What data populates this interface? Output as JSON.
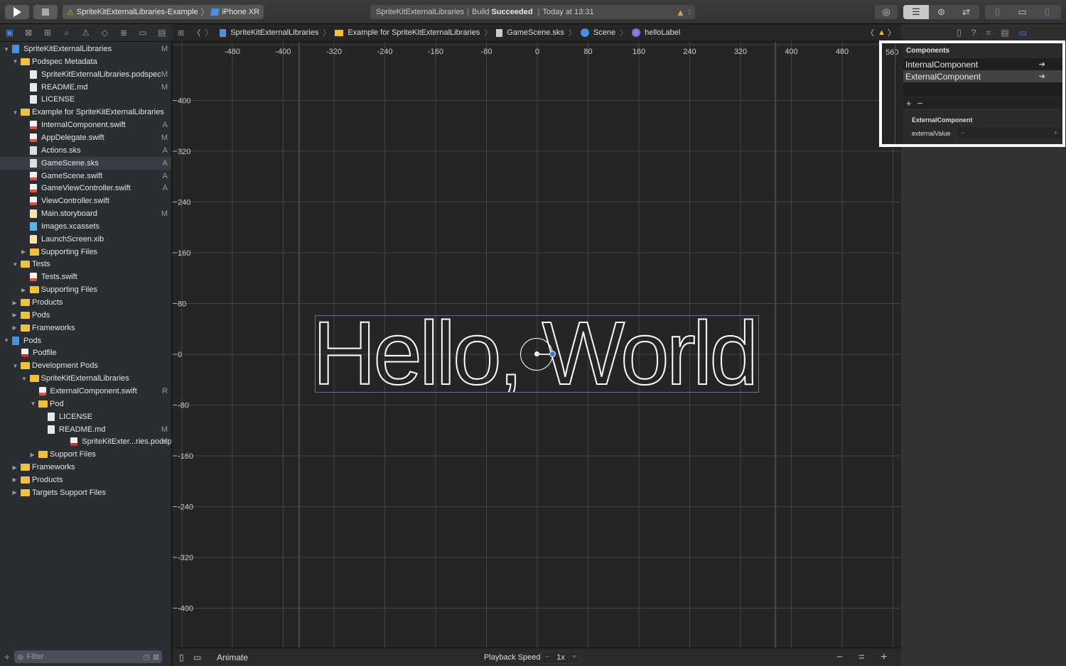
{
  "toolbar": {
    "run_icon": "play-icon",
    "stop_icon": "stop-icon",
    "scheme": "SpriteKitExternalLibraries-Example",
    "device": "iPhone XR",
    "status_project": "SpriteKitExternalLibraries",
    "status_build_prefix": "Build",
    "status_build": "Succeeded",
    "status_time": "Today at 13:31",
    "warning_count": "1"
  },
  "jumpbar": {
    "items": [
      "SpriteKitExternalLibraries",
      "Example for SpriteKitExternalLibraries",
      "GameScene.sks",
      "Scene",
      "helloLabel"
    ]
  },
  "navigator": {
    "items": [
      {
        "label": "SpriteKitExternalLibraries",
        "badge": "M",
        "depth": 0,
        "type": "proj",
        "tri": "▼"
      },
      {
        "label": "Podspec Metadata",
        "badge": "",
        "depth": 1,
        "type": "folder",
        "tri": "▼"
      },
      {
        "label": "SpriteKitExternalLibraries.podspec",
        "badge": "M",
        "depth": 2,
        "type": "file",
        "tri": ""
      },
      {
        "label": "README.md",
        "badge": "M",
        "depth": 2,
        "type": "file",
        "tri": ""
      },
      {
        "label": "LICENSE",
        "badge": "",
        "depth": 2,
        "type": "file",
        "tri": ""
      },
      {
        "label": "Example for SpriteKitExternalLibraries",
        "badge": "",
        "depth": 1,
        "type": "folder",
        "tri": "▼"
      },
      {
        "label": "InternalComponent.swift",
        "badge": "A",
        "depth": 2,
        "type": "swift",
        "tri": ""
      },
      {
        "label": "AppDelegate.swift",
        "badge": "M",
        "depth": 2,
        "type": "swift",
        "tri": ""
      },
      {
        "label": "Actions.sks",
        "badge": "A",
        "depth": 2,
        "type": "sks",
        "tri": ""
      },
      {
        "label": "GameScene.sks",
        "badge": "A",
        "depth": 2,
        "type": "sks",
        "tri": "",
        "selected": true
      },
      {
        "label": "GameScene.swift",
        "badge": "A",
        "depth": 2,
        "type": "swift",
        "tri": ""
      },
      {
        "label": "GameViewController.swift",
        "badge": "A",
        "depth": 2,
        "type": "swift",
        "tri": ""
      },
      {
        "label": "ViewController.swift",
        "badge": "",
        "depth": 2,
        "type": "swift",
        "tri": ""
      },
      {
        "label": "Main.storyboard",
        "badge": "M",
        "depth": 2,
        "type": "storyboard",
        "tri": ""
      },
      {
        "label": "Images.xcassets",
        "badge": "",
        "depth": 2,
        "type": "assets",
        "tri": ""
      },
      {
        "label": "LaunchScreen.xib",
        "badge": "",
        "depth": 2,
        "type": "storyboard",
        "tri": ""
      },
      {
        "label": "Supporting Files",
        "badge": "",
        "depth": 2,
        "type": "folder",
        "tri": "▶"
      },
      {
        "label": "Tests",
        "badge": "",
        "depth": 1,
        "type": "folder",
        "tri": "▼"
      },
      {
        "label": "Tests.swift",
        "badge": "",
        "depth": 2,
        "type": "swift",
        "tri": ""
      },
      {
        "label": "Supporting Files",
        "badge": "",
        "depth": 2,
        "type": "folder",
        "tri": "▶"
      },
      {
        "label": "Products",
        "badge": "",
        "depth": 1,
        "type": "folder",
        "tri": "▶"
      },
      {
        "label": "Pods",
        "badge": "",
        "depth": 1,
        "type": "folder",
        "tri": "▶"
      },
      {
        "label": "Frameworks",
        "badge": "",
        "depth": 1,
        "type": "folder",
        "tri": "▶"
      },
      {
        "label": "Pods",
        "badge": "",
        "depth": 0,
        "type": "proj",
        "tri": "▼"
      },
      {
        "label": "Podfile",
        "badge": "",
        "depth": 1.5,
        "type": "ruby",
        "tri": ""
      },
      {
        "label": "Development Pods",
        "badge": "",
        "depth": 1,
        "type": "folder",
        "tri": "▼"
      },
      {
        "label": "SpriteKitExternalLibraries",
        "badge": "",
        "depth": 2,
        "type": "folder",
        "tri": "▼"
      },
      {
        "label": "ExternalComponent.swift",
        "badge": "R",
        "depth": 3,
        "type": "swift",
        "tri": ""
      },
      {
        "label": "Pod",
        "badge": "",
        "depth": 3,
        "type": "folder",
        "tri": "▼"
      },
      {
        "label": "LICENSE",
        "badge": "",
        "depth": 4,
        "type": "file",
        "tri": ""
      },
      {
        "label": "README.md",
        "badge": "M",
        "depth": 4,
        "type": "file",
        "tri": ""
      },
      {
        "label": "SpriteKitExter...ries.podspec",
        "badge": "M",
        "depth": 4,
        "type": "ruby",
        "tri": ""
      },
      {
        "label": "Support Files",
        "badge": "",
        "depth": 3,
        "type": "folder",
        "tri": "▶"
      },
      {
        "label": "Frameworks",
        "badge": "",
        "depth": 1,
        "type": "folder",
        "tri": "▶"
      },
      {
        "label": "Products",
        "badge": "",
        "depth": 1,
        "type": "folder",
        "tri": "▶"
      },
      {
        "label": "Targets Support Files",
        "badge": "",
        "depth": 1,
        "type": "folder",
        "tri": "▶"
      }
    ],
    "filter_placeholder": "Filter"
  },
  "canvas": {
    "x_ticks": [
      "-480",
      "-400",
      "-320",
      "-240",
      "-160",
      "-80",
      "0",
      "80",
      "160",
      "240",
      "320",
      "400",
      "480",
      "560"
    ],
    "y_ticks": [
      "400",
      "320",
      "240",
      "160",
      "80",
      "0",
      "-80",
      "-160",
      "-240",
      "-320",
      "-400"
    ],
    "label_text": "Hello, World!"
  },
  "footer": {
    "animate": "Animate",
    "playback_label": "Playback Speed",
    "playback_minus": "−",
    "playback_value": "1x",
    "playback_plus": "+",
    "zoom_out": "−",
    "zoom_fit": "=",
    "zoom_in": "+"
  },
  "inspector": {
    "section_title": "Components",
    "components": [
      "InternalComponent",
      "ExternalComponent"
    ],
    "add": "+",
    "remove": "−",
    "detail_title": "ExternalComponent",
    "property_label": "externalValue",
    "stepper_minus": "−",
    "stepper_plus": "+"
  }
}
